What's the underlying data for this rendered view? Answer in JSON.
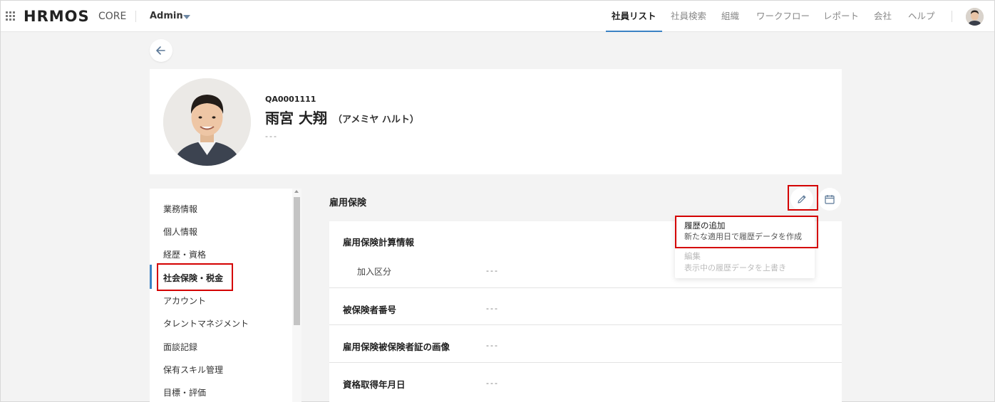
{
  "header": {
    "logo": "HRMOS",
    "logo_sub": "CORE",
    "admin_label": "Admin",
    "nav": [
      {
        "label": "社員リスト",
        "active": true
      },
      {
        "label": "社員検索",
        "active": false
      },
      {
        "label": "組織",
        "active": false
      },
      {
        "label": "ワークフロー",
        "active": false
      },
      {
        "label": "レポート",
        "active": false
      },
      {
        "label": "会社",
        "active": false
      },
      {
        "label": "ヘルプ",
        "active": false
      }
    ]
  },
  "profile": {
    "employee_id": "QA0001111",
    "name": "雨宮 大翔",
    "kana": "（アメミヤ ハルト）",
    "sub": "---"
  },
  "sidebar": {
    "items": [
      {
        "label": "業務情報",
        "active": false
      },
      {
        "label": "個人情報",
        "active": false
      },
      {
        "label": "経歴・資格",
        "active": false
      },
      {
        "label": "社会保険・税金",
        "active": true
      },
      {
        "label": "アカウント",
        "active": false
      },
      {
        "label": "タレントマネジメント",
        "active": false
      },
      {
        "label": "面談記録",
        "active": false
      },
      {
        "label": "保有スキル管理",
        "active": false
      },
      {
        "label": "目標・評価",
        "active": false
      }
    ]
  },
  "section": {
    "title": "雇用保険",
    "rows": {
      "calc_title": "雇用保険計算情報",
      "enrollment_label": "加入区分",
      "enrollment_value": "---",
      "insured_number_label": "被保険者番号",
      "insured_number_value": "---",
      "certificate_image_label": "雇用保険被保険者証の画像",
      "certificate_image_value": "---",
      "acquisition_date_label": "資格取得年月日",
      "acquisition_date_value": "---"
    }
  },
  "dropdown": {
    "items": [
      {
        "title": "履歴の追加",
        "desc": "新たな適用日で履歴データを作成",
        "enabled": true
      },
      {
        "title": "編集",
        "desc": "表示中の履歴データを上書き",
        "enabled": false
      }
    ]
  },
  "colors": {
    "accent": "#3b82c4",
    "highlight": "#d40000",
    "background": "#f3f3f3"
  }
}
